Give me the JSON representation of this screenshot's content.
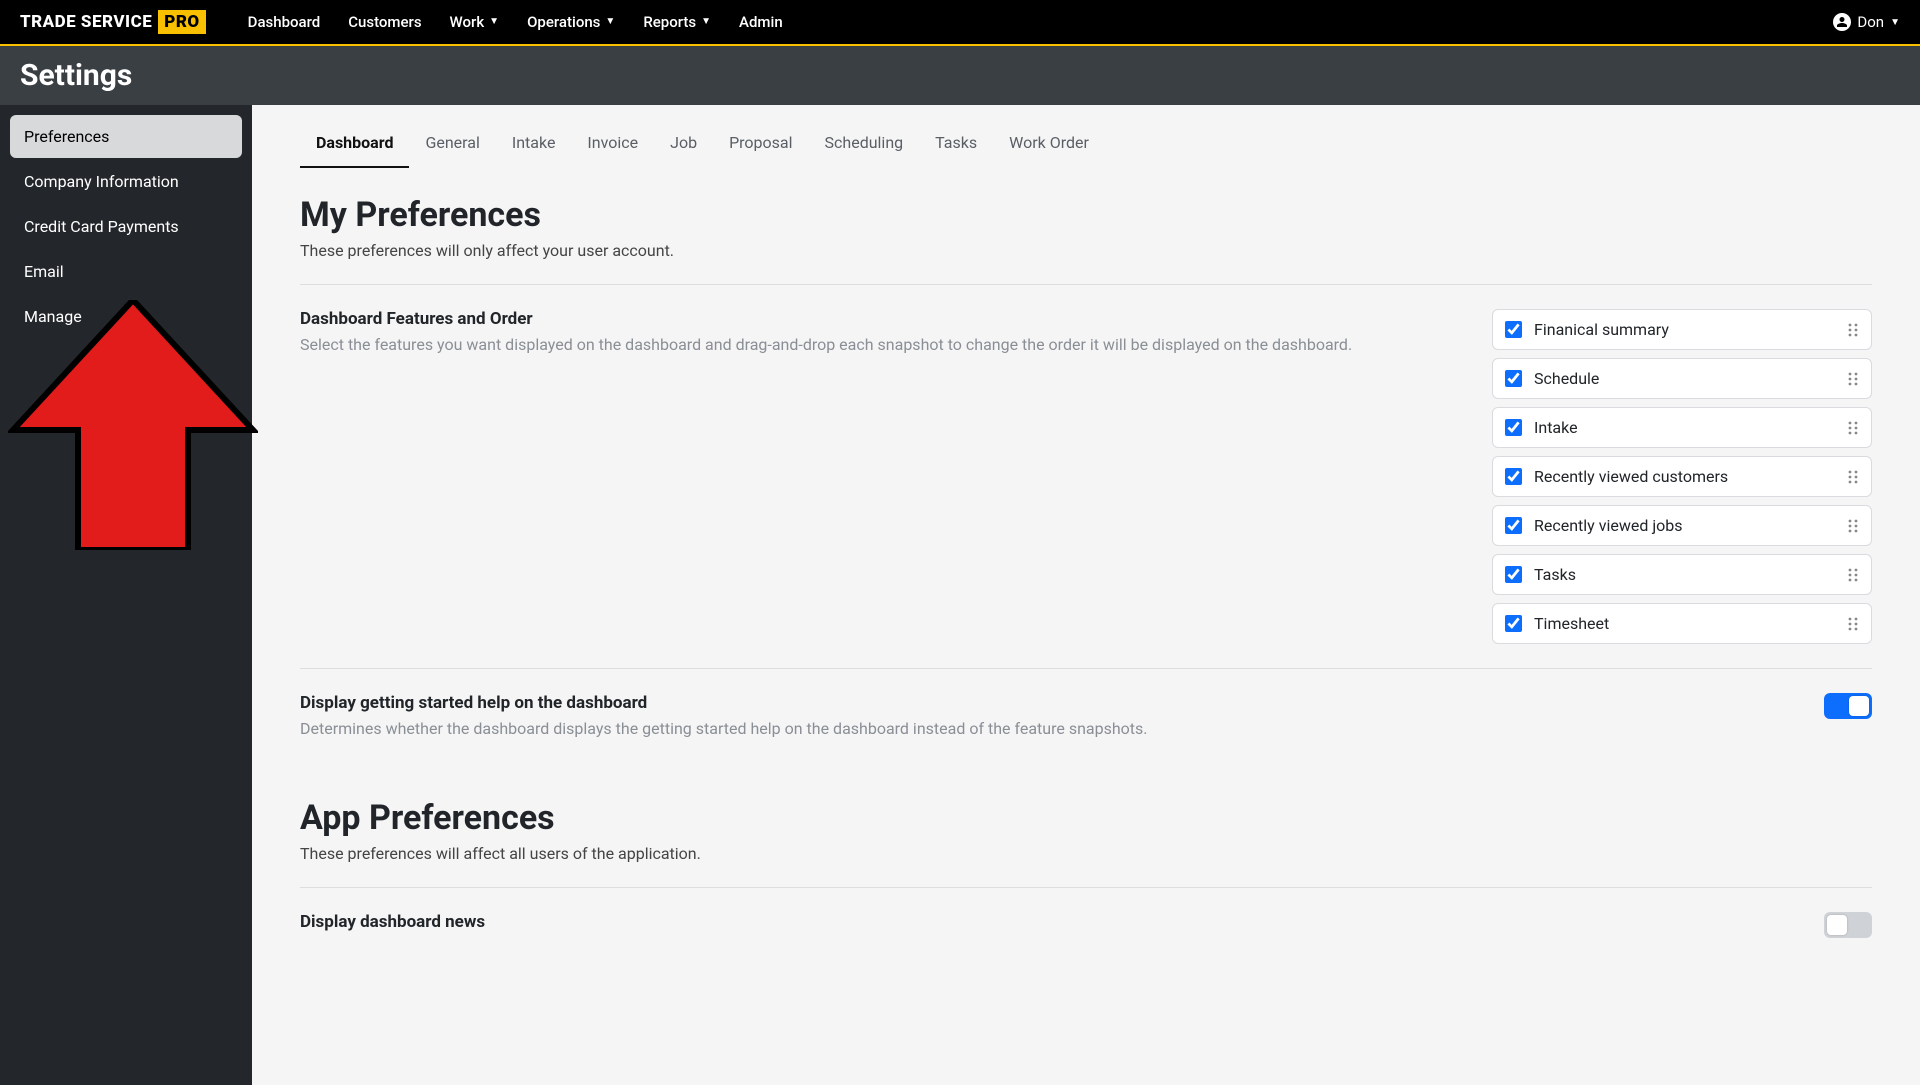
{
  "brand": {
    "text1": "TRADE SERVICE",
    "text2": "PRO"
  },
  "nav": {
    "dashboard": "Dashboard",
    "customers": "Customers",
    "work": "Work",
    "operations": "Operations",
    "reports": "Reports",
    "admin": "Admin"
  },
  "user": {
    "name": "Don"
  },
  "page_title": "Settings",
  "sidebar": {
    "items": [
      {
        "label": "Preferences",
        "active": true
      },
      {
        "label": "Company Information"
      },
      {
        "label": "Credit Card Payments"
      },
      {
        "label": "Email"
      },
      {
        "label": "Manage"
      }
    ]
  },
  "tabs": [
    {
      "label": "Dashboard",
      "active": true
    },
    {
      "label": "General"
    },
    {
      "label": "Intake"
    },
    {
      "label": "Invoice"
    },
    {
      "label": "Job"
    },
    {
      "label": "Proposal"
    },
    {
      "label": "Scheduling"
    },
    {
      "label": "Tasks"
    },
    {
      "label": "Work Order"
    }
  ],
  "my_prefs": {
    "title": "My Preferences",
    "subtitle": "These preferences will only affect your user account.",
    "features": {
      "label": "Dashboard Features and Order",
      "desc": "Select the features you want displayed on the dashboard and drag-and-drop each snapshot to change the order it will be displayed on the dashboard.",
      "items": [
        {
          "name": "Finanical summary",
          "checked": true
        },
        {
          "name": "Schedule",
          "checked": true
        },
        {
          "name": "Intake",
          "checked": true
        },
        {
          "name": "Recently viewed customers",
          "checked": true
        },
        {
          "name": "Recently viewed jobs",
          "checked": true
        },
        {
          "name": "Tasks",
          "checked": true
        },
        {
          "name": "Timesheet",
          "checked": true
        }
      ]
    },
    "getting_started": {
      "label": "Display getting started help on the dashboard",
      "desc": "Determines whether the dashboard displays the getting started help on the dashboard instead of the feature snapshots.",
      "value": true
    }
  },
  "app_prefs": {
    "title": "App Preferences",
    "subtitle": "These preferences will affect all users of the application.",
    "dashboard_news": {
      "label": "Display dashboard news",
      "value": false
    }
  },
  "colors": {
    "accent": "#0d6efd",
    "brand_yellow": "#f9c000"
  }
}
